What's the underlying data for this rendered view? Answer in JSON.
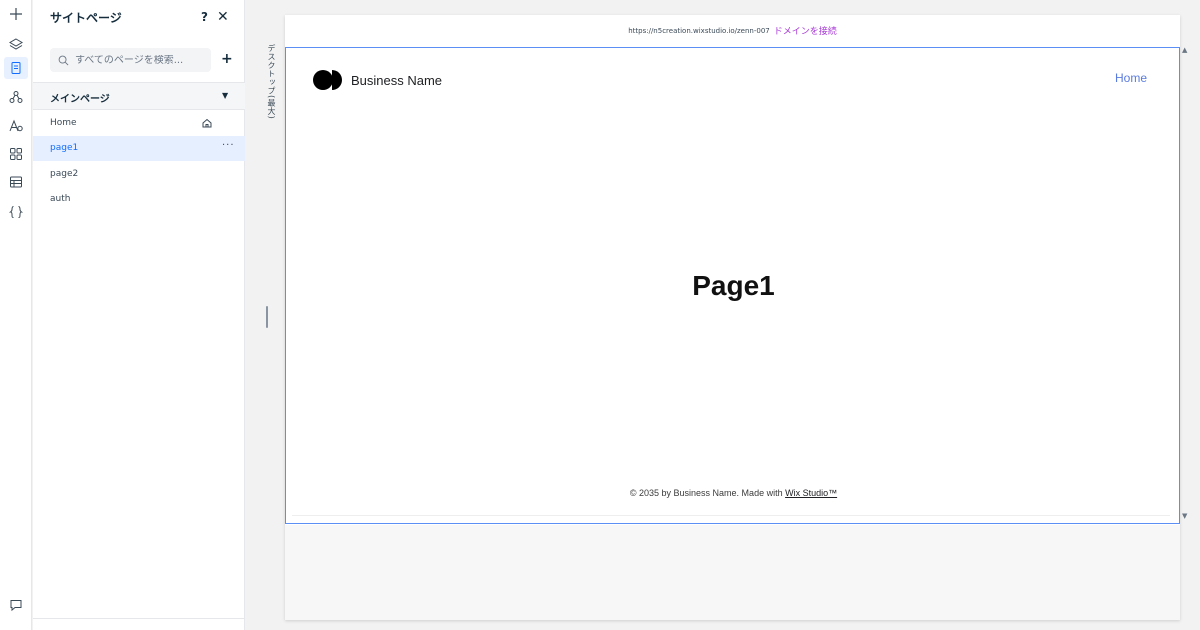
{
  "toolbar": {
    "items": [
      {
        "name": "add-elements-icon",
        "glyph": "+"
      },
      {
        "name": "layers-icon"
      },
      {
        "name": "pages-icon",
        "active": true
      },
      {
        "name": "site-structure-icon"
      },
      {
        "name": "theme-text-icon",
        "glyph": "A"
      },
      {
        "name": "apps-icon"
      },
      {
        "name": "cms-icon"
      },
      {
        "name": "code-icon",
        "glyph": "{ }"
      },
      {
        "name": "comments-icon"
      }
    ]
  },
  "panel": {
    "title": "サイトページ",
    "help": "?",
    "close": "✕",
    "search_placeholder": "すべてのページを検索...",
    "add": "+",
    "section": {
      "label": "メインページ",
      "caret": "▼"
    },
    "pages": [
      {
        "label": "Home",
        "is_home": true
      },
      {
        "label": "page1",
        "selected": true,
        "more": "···"
      },
      {
        "label": "page2"
      },
      {
        "label": "auth"
      }
    ]
  },
  "canvas": {
    "viewport_label": "デスクトップ(最大)",
    "url": "https://n5creation.wixstudio.io/zenn-007",
    "connect_domain": "ドメインを接続",
    "site": {
      "business_name": "Business Name",
      "nav_home": "Home",
      "heading": "Page1",
      "footer_prefix": "© 2035 by Business Name. Made with ",
      "footer_link": "Wix Studio™"
    }
  },
  "colors": {
    "accent": "#116dff",
    "connect": "#a83ad6",
    "selection_outline": "#5b8ff5"
  }
}
